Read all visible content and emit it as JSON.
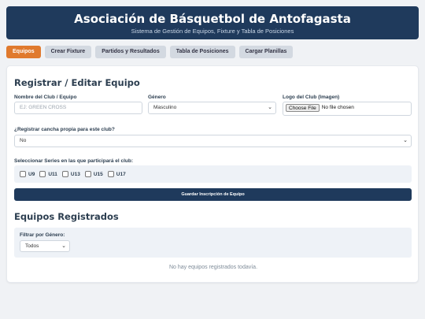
{
  "header": {
    "title": "Asociación de Básquetbol de Antofagasta",
    "subtitle": "Sistema de Gestión de Equipos, Fixture y Tabla de Posiciones"
  },
  "tabs": [
    {
      "label": "Equipos",
      "active": true
    },
    {
      "label": "Crear Fixture",
      "active": false
    },
    {
      "label": "Partidos y Resultados",
      "active": false
    },
    {
      "label": "Tabla de Posiciones",
      "active": false
    },
    {
      "label": "Cargar Planillas",
      "active": false
    }
  ],
  "form": {
    "title": "Registrar / Editar Equipo",
    "club_label": "Nombre del Club / Equipo",
    "club_placeholder": "EJ: GREEN CROSS",
    "genero_label": "Género",
    "genero_value": "Masculino",
    "logo_label": "Logo del Club (Imagen)",
    "file_button": "Choose File",
    "file_status": "No file chosen",
    "cancha_label": "¿Registrar cancha propia para este club?",
    "cancha_value": "No",
    "series_label": "Seleccionar Series en las que participará el club:",
    "series": [
      "U9",
      "U11",
      "U13",
      "U15",
      "U17"
    ],
    "save_button": "Guardar Inscripción de Equipo"
  },
  "registered": {
    "title": "Equipos Registrados",
    "filter_label": "Filtrar por Género:",
    "filter_value": "Todos",
    "empty_message": "No hay equipos registrados todavía."
  },
  "colors": {
    "header_bg": "#1f3a5c",
    "active_tab": "#e07a2e",
    "inactive_tab": "#d3d9e1"
  }
}
